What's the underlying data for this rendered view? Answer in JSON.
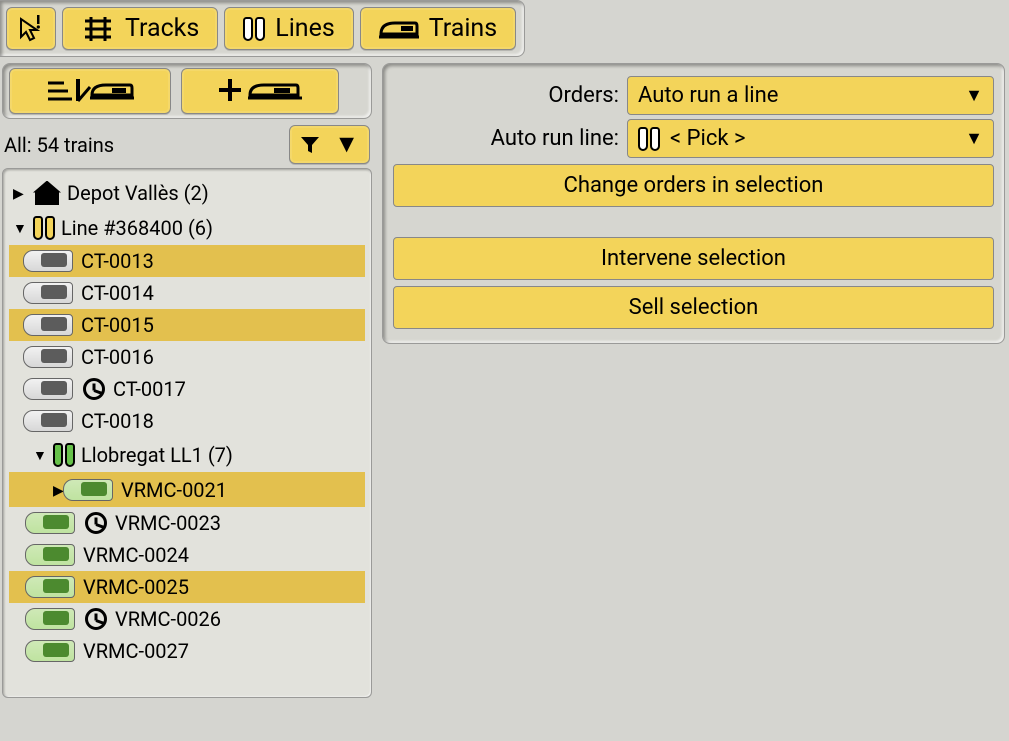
{
  "toolbar": {
    "tracks": "Tracks",
    "lines": "Lines",
    "trains": "Trains"
  },
  "left": {
    "summary": "All: 54 trains"
  },
  "tree": {
    "groups": [
      {
        "kind": "depot",
        "label": "Depot Vallès (2)",
        "open": false
      },
      {
        "kind": "line",
        "label": "Line #368400 (6)",
        "color": "yellow",
        "open": true,
        "trains": [
          {
            "id": "CT-0013",
            "selected": true
          },
          {
            "id": "CT-0014",
            "selected": false
          },
          {
            "id": "CT-0015",
            "selected": true
          },
          {
            "id": "CT-0016",
            "selected": false
          },
          {
            "id": "CT-0017",
            "selected": false,
            "clocked": true
          },
          {
            "id": "CT-0018",
            "selected": false
          }
        ]
      },
      {
        "kind": "line",
        "label": "Llobregat LL1 (7)",
        "color": "green",
        "open": true,
        "indent": true,
        "trains": [
          {
            "id": "VRMC-0021",
            "selected": true,
            "green": true,
            "expandable": true
          },
          {
            "id": "VRMC-0023",
            "selected": false,
            "green": true,
            "clocked": true
          },
          {
            "id": "VRMC-0024",
            "selected": false,
            "green": true
          },
          {
            "id": "VRMC-0025",
            "selected": true,
            "green": true
          },
          {
            "id": "VRMC-0026",
            "selected": false,
            "green": true,
            "clocked": true
          },
          {
            "id": "VRMC-0027",
            "selected": false,
            "green": true
          }
        ]
      }
    ]
  },
  "orders": {
    "orders_label": "Orders:",
    "orders_value": "Auto run a line",
    "autorun_label": "Auto run line:",
    "autorun_value": "< Pick >",
    "change_btn": "Change orders in selection",
    "intervene_btn": "Intervene selection",
    "sell_btn": "Sell selection"
  }
}
